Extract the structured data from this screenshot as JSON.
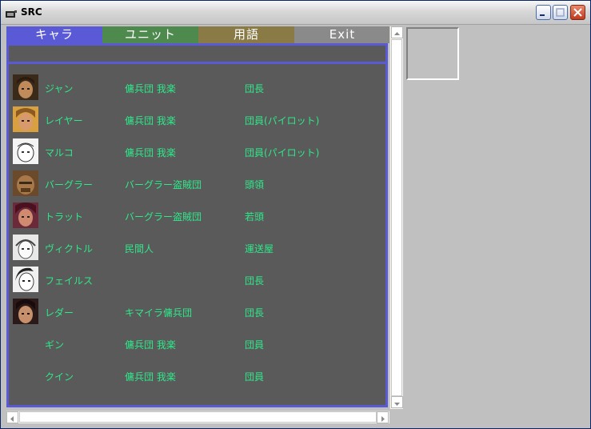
{
  "window": {
    "title": "SRC"
  },
  "tabs": [
    {
      "label": "キャラ"
    },
    {
      "label": "ユニット"
    },
    {
      "label": "用語"
    },
    {
      "label": "Exit"
    }
  ],
  "characters": [
    {
      "name": "ジャン",
      "group": "傭兵団 我楽",
      "role": "団長"
    },
    {
      "name": "レイヤー",
      "group": "傭兵団 我楽",
      "role": "団員(パイロット)"
    },
    {
      "name": "マルコ",
      "group": "傭兵団 我楽",
      "role": "団員(パイロット)"
    },
    {
      "name": "バーグラー",
      "group": "バーグラー盗賊団",
      "role": "頭領"
    },
    {
      "name": "トラット",
      "group": "バーグラー盗賊団",
      "role": "若頭"
    },
    {
      "name": "ヴィクトル",
      "group": "民間人",
      "role": "運送屋"
    },
    {
      "name": "フェイルス",
      "group": "",
      "role": "団長"
    },
    {
      "name": "レダー",
      "group": "キマイラ傭兵団",
      "role": "団長"
    },
    {
      "name": "ギン",
      "group": "傭兵団 我楽",
      "role": "団員"
    },
    {
      "name": "クイン",
      "group": "傭兵団 我楽",
      "role": "団員"
    }
  ],
  "colors": {
    "tab_chara": "#5a5ad6",
    "tab_unit": "#4e8a4e",
    "tab_term": "#8a7a46",
    "tab_exit": "#8a8a8a",
    "text_green": "#2ee88a",
    "panel": "#5a5a5a"
  }
}
